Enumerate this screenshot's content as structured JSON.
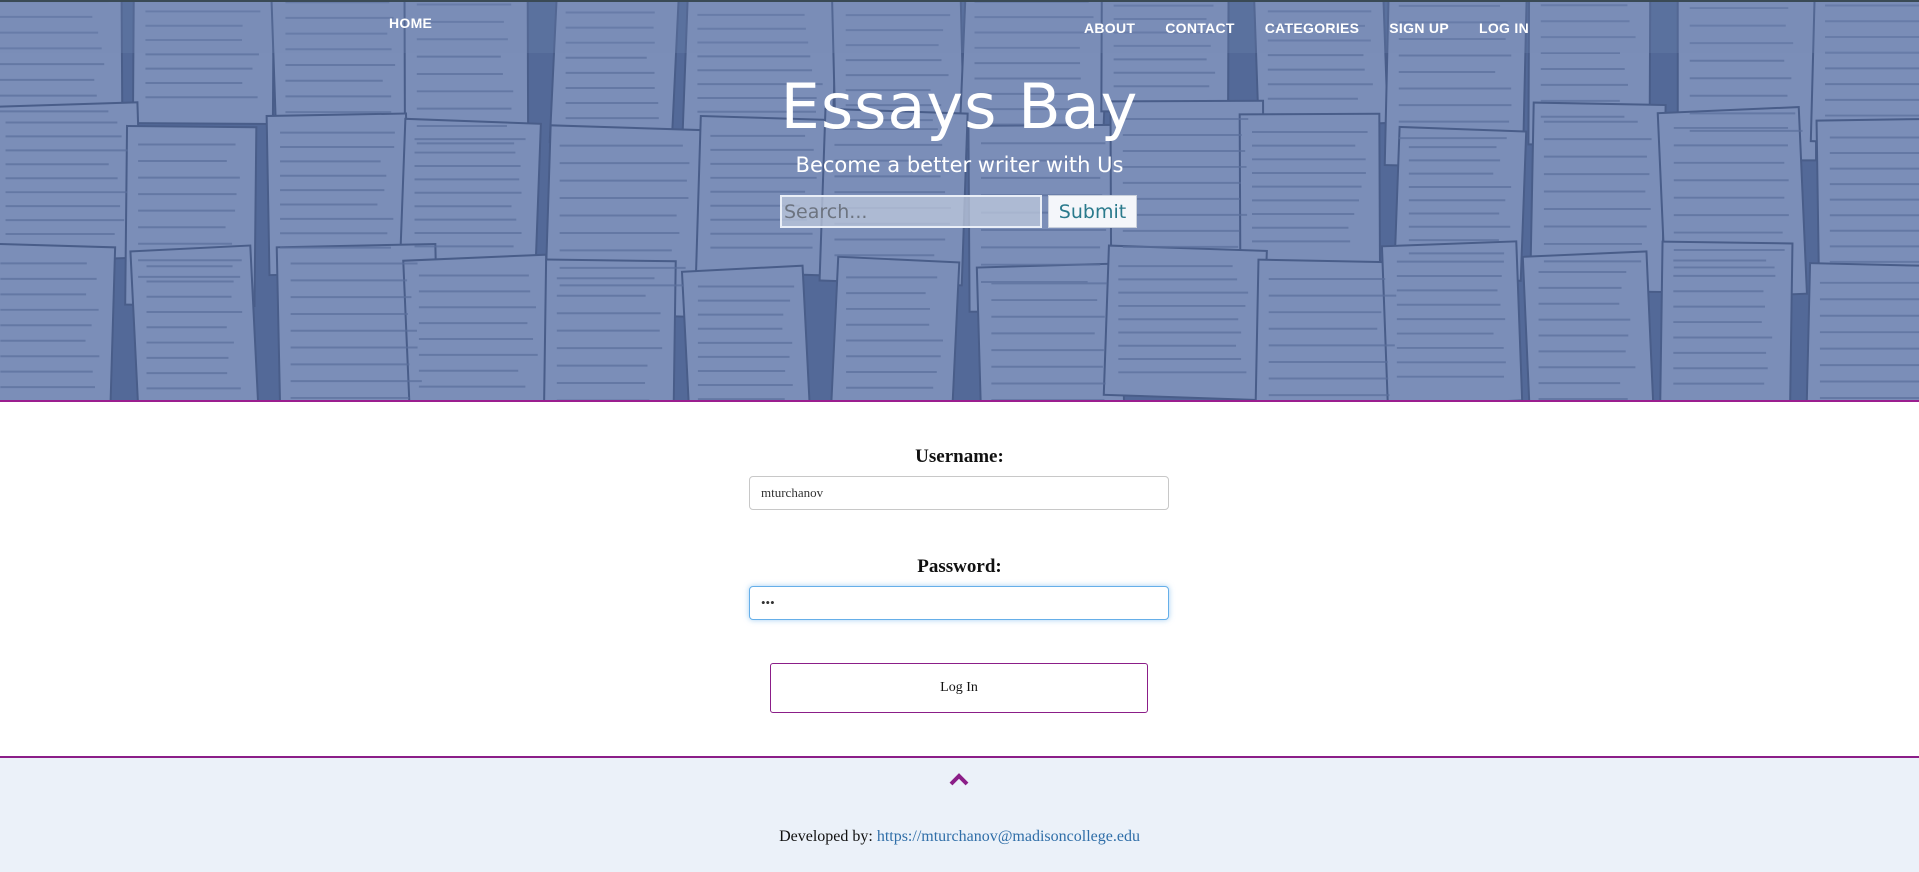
{
  "nav": {
    "home": "HOME",
    "links": [
      "ABOUT",
      "CONTACT",
      "CATEGORIES",
      "SIGN UP",
      "LOG IN"
    ]
  },
  "hero": {
    "title": "Essays Bay",
    "subtitle": "Become a better writer with Us",
    "search_placeholder": "Search...",
    "submit_label": "Submit",
    "background_image": "books-background"
  },
  "login": {
    "username_label": "Username:",
    "username_value": "mturchanov",
    "password_label": "Password:",
    "password_value": "•••",
    "button_label": "Log In"
  },
  "footer": {
    "back_to_top_icon": "chevron-up-icon",
    "developed_by_label": "Developed by:",
    "developer_link": "https://mturchanov@madisoncollege.edu"
  },
  "colors": {
    "accent": "#8b1e88",
    "link": "#2f6ea8",
    "hero_tint": "#5b6f99",
    "footer_bg": "#ebf1f9"
  }
}
